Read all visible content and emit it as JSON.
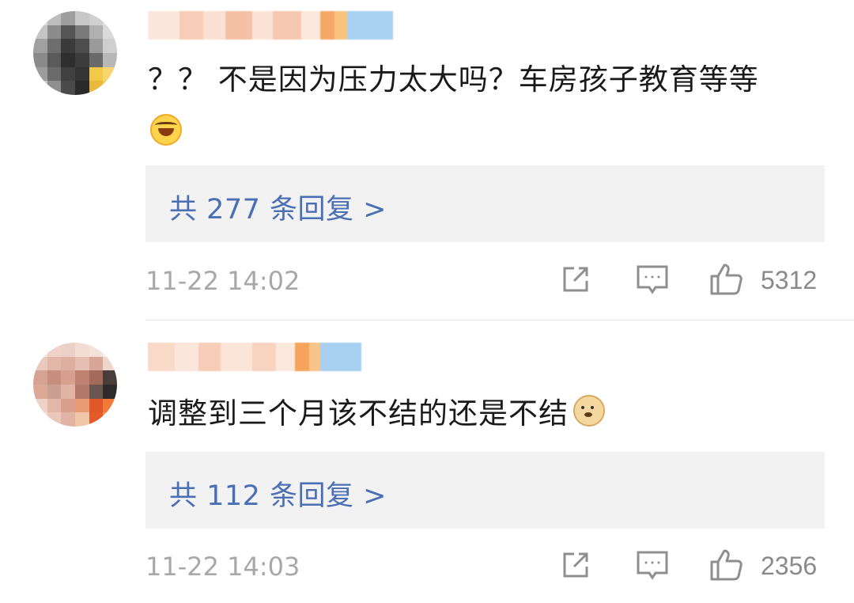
{
  "comments": [
    {
      "text": "？？ 不是因为压力太大吗？车房孩子教育等等",
      "emoji_after_text": "",
      "emoji_line": "laughing-crying-emoji",
      "replies_label": "共 277 条回复 >",
      "timestamp": "11-22 14:02",
      "likes": "5312"
    },
    {
      "text": "调整到三个月该不结的还是不结",
      "emoji_after_text": "doge-emoji",
      "emoji_line": "",
      "replies_label": "共 112 条回复 >",
      "timestamp": "11-22 14:03",
      "likes": "2356"
    }
  ],
  "colors": {
    "link": "#4a6fb5",
    "meta_gray": "#a8a8a8",
    "reply_box_bg": "#f2f2f2"
  }
}
